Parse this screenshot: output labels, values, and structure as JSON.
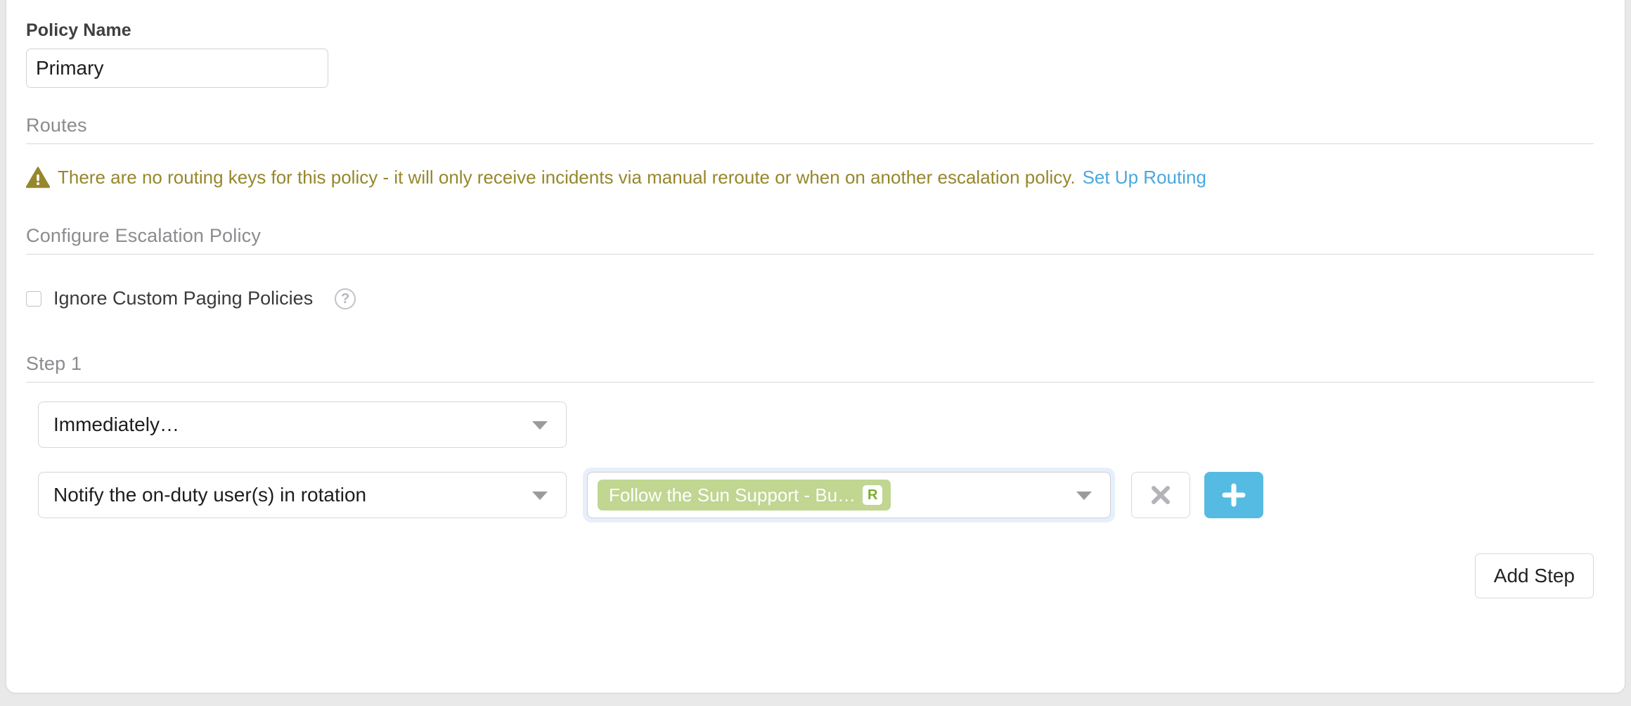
{
  "policy": {
    "name_label": "Policy Name",
    "name_value": "Primary",
    "name_placeholder": "Policy Name"
  },
  "routes": {
    "heading": "Routes",
    "warning_text": "There are no routing keys for this policy - it will only receive incidents via manual reroute or when on another escalation policy.",
    "warning_link": "Set Up Routing",
    "warning_icon": "warning-triangle-icon",
    "warning_color": "#96872c",
    "link_color": "#4aa8dd"
  },
  "configure": {
    "heading": "Configure Escalation Policy",
    "ignore_policies_label": "Ignore Custom Paging Policies",
    "ignore_policies_checked": false,
    "help_icon": "?",
    "help_icon_name": "help-circle-icon"
  },
  "step": {
    "heading": "Step 1",
    "delay_select_value": "Immediately…",
    "action_select_value": "Notify the on-duty user(s) in rotation",
    "target_token_label": "Follow the Sun Support - Bu…",
    "target_token_badge": "R",
    "token_color": "#c0d691",
    "remove_icon": "close-x-icon",
    "add_icon": "plus-icon",
    "add_button_color": "#56bbe2"
  },
  "footer": {
    "add_step_label": "Add Step"
  }
}
